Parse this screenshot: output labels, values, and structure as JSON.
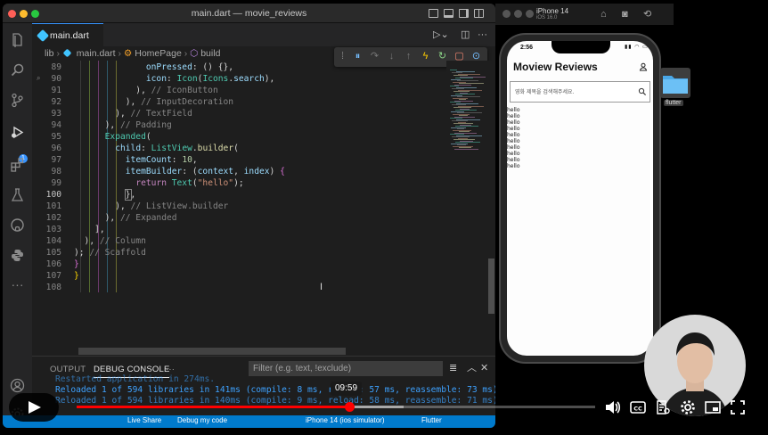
{
  "vscode": {
    "title": "main.dart — movie_reviews",
    "tab": "main.dart",
    "breadcrumb": {
      "folder": "lib",
      "file": "main.dart",
      "class": "HomePage",
      "method": "build"
    },
    "code_lines": [
      {
        "n": "89",
        "html": "              <span style='color:#9cdcfe'>onPressed</span>: () {},",
        "active": false
      },
      {
        "n": "90",
        "html": "              <span style='color:#9cdcfe'>icon</span>: <span style='color:#4ec9b0'>Icon</span>(<span style='color:#4ec9b0'>Icons</span>.<span style='color:#9cdcfe'>search</span>),",
        "active": false
      },
      {
        "n": "91",
        "html": "            ), <span style='color:#858585'>// IconButton</span>",
        "active": false
      },
      {
        "n": "92",
        "html": "          ), <span style='color:#858585'>// InputDecoration</span>",
        "active": false
      },
      {
        "n": "93",
        "html": "        ), <span style='color:#858585'>// TextField</span>",
        "active": false
      },
      {
        "n": "94",
        "html": "      ), <span style='color:#858585'>// Padding</span>",
        "active": false
      },
      {
        "n": "95",
        "html": "      <span style='color:#4ec9b0'>Expanded</span>(",
        "active": false
      },
      {
        "n": "96",
        "html": "        <span style='color:#9cdcfe'>child</span>: <span style='color:#4ec9b0'>ListView</span>.<span style='color:#dcdcaa'>builder</span>(",
        "active": false
      },
      {
        "n": "97",
        "html": "          <span style='color:#9cdcfe'>itemCount</span>: <span style='color:#b5cea8'>10</span>,",
        "active": false
      },
      {
        "n": "98",
        "html": "          <span style='color:#9cdcfe'>itemBuilder</span>: (<span style='color:#9cdcfe'>context</span>, <span style='color:#9cdcfe'>index</span>) <span style='color:#da70d6'>{</span>",
        "active": false
      },
      {
        "n": "99",
        "html": "            <span style='color:#c586c0'>return</span> <span style='color:#4ec9b0'>Text</span>(<span style='color:#ce9178'>\"hello\"</span>);",
        "active": false
      },
      {
        "n": "100",
        "html": "          <span style='outline:1px solid #888'>}</span>,",
        "active": true
      },
      {
        "n": "101",
        "html": "        ), <span style='color:#858585'>// ListView.builder</span>",
        "active": false
      },
      {
        "n": "102",
        "html": "      ), <span style='color:#858585'>// Expanded</span>",
        "active": false
      },
      {
        "n": "103",
        "html": "    ],",
        "active": false
      },
      {
        "n": "104",
        "html": "  ), <span style='color:#858585'>// Column</span>",
        "active": false
      },
      {
        "n": "105",
        "html": "); <span style='color:#858585'>// Scaffold</span>",
        "active": false
      },
      {
        "n": "106",
        "html": "<span style='color:#da70d6'>}</span>",
        "active": false
      },
      {
        "n": "107",
        "html": "<span style='color:#ffd700'>}</span>",
        "active": false
      },
      {
        "n": "108",
        "html": "",
        "active": false
      }
    ],
    "panel": {
      "tab_output": "OUTPUT",
      "tab_debug": "DEBUG CONSOLE",
      "more": "···",
      "filter_placeholder": "Filter (e.g. text, !exclude)",
      "console_lines": [
        "Restarted application in 274ms.",
        "Reloaded 1 of 594 libraries in 141ms (compile: 8 ms, reload: 57 ms, reassemble: 73 ms).",
        "Reloaded 1 of 594 libraries in 140ms (compile: 9 ms, reload: 58 ms, reassemble: 71 ms)."
      ]
    },
    "status": {
      "live_share": "Live Share",
      "debug": "Debug my code",
      "device": "iPhone 14 (ios simulator)",
      "flutter": "Flutter"
    }
  },
  "simulator": {
    "device": "iPhone 14",
    "os": "iOS 16.0",
    "status_time": "2:56",
    "status_icons": "▮▮ ◠ ▭",
    "app_title": "Moview Reviews",
    "search_placeholder": "영화 제목을 검색해주세요.",
    "list_items": [
      "hello",
      "hello",
      "hello",
      "hello",
      "hello",
      "hello",
      "hello",
      "hello",
      "hello",
      "hello"
    ]
  },
  "desktop": {
    "folder_label": "flutter"
  },
  "video": {
    "time_tooltip": "09:59",
    "played_fraction": 0.525,
    "buffered_fraction": 0.63,
    "accent": "#ff0000"
  }
}
